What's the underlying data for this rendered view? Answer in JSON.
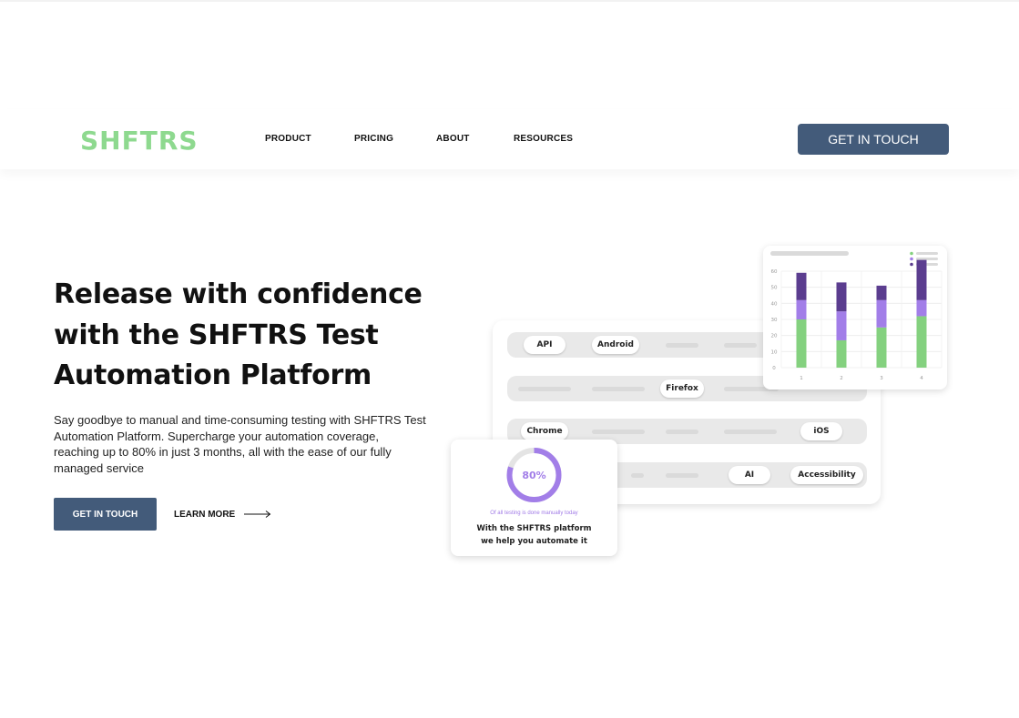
{
  "header": {
    "logo": "SHFTRS",
    "nav": [
      {
        "label": "PRODUCT"
      },
      {
        "label": "PRICING"
      },
      {
        "label": "ABOUT"
      },
      {
        "label": "RESOURCES"
      }
    ],
    "cta_label": "GET IN TOUCH"
  },
  "hero": {
    "title_lines": [
      "Release with confidence",
      "with the SHFTRS Test",
      "Automation Platform"
    ],
    "description": "Say goodbye to manual and time-consuming testing with SHFTRS Test Automation Platform. Supercharge your automation coverage, reaching up to 80% in just 3 months, all with the ease of our fully managed service",
    "primary_button": "GET IN TOUCH",
    "secondary_link": "LEARN MORE"
  },
  "illustration": {
    "tags": {
      "api": "API",
      "android": "Android",
      "firefox": "Firefox",
      "chrome": "Chrome",
      "ios": "iOS",
      "ai": "AI",
      "accessibility": "Accessibility"
    },
    "donut": {
      "label": "80%",
      "percent": 80,
      "caption_small": "Of all testing is done manually today",
      "caption_line1": "With the SHFTRS platform",
      "caption_line2": "we help you automate it"
    }
  },
  "chart_data": {
    "type": "bar",
    "categories": [
      "1",
      "2",
      "3",
      "4"
    ],
    "yticks": [
      "0",
      "10",
      "20",
      "30",
      "40",
      "50",
      "60"
    ],
    "ylim": [
      0,
      60
    ],
    "series": [
      {
        "values": [
          30,
          17,
          25,
          32
        ]
      },
      {
        "values": [
          12,
          18,
          17,
          10
        ]
      },
      {
        "values": [
          17,
          18,
          9,
          25
        ]
      }
    ]
  },
  "colors": {
    "brand_green": "#8ed98f",
    "button_blue": "#435b7a",
    "series": [
      "#84d17f",
      "#a27ee8",
      "#5b3d8f"
    ],
    "donut": "#a27ee8"
  }
}
